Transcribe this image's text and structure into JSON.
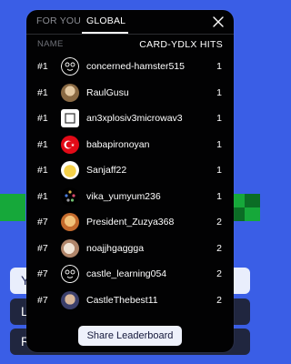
{
  "background": {
    "buttons": [
      "Y",
      "L",
      "R"
    ]
  },
  "tabs": [
    {
      "label": "FOR YOU",
      "active": false
    },
    {
      "label": "GLOBAL",
      "active": true
    }
  ],
  "columns": {
    "name": "NAME",
    "hits": "CARD-YDLX HITS"
  },
  "leaderboard": [
    {
      "rank": "#1",
      "name": "concerned-hamster515",
      "hits": "1",
      "avatar_icon": "hamster-icon"
    },
    {
      "rank": "#1",
      "name": "RaulGusu",
      "hits": "1",
      "avatar_icon": "user-photo-icon"
    },
    {
      "rank": "#1",
      "name": "an3xplosiv3microwav3",
      "hits": "1",
      "avatar_icon": "default-avatar-icon"
    },
    {
      "rank": "#1",
      "name": "babapironoyan",
      "hits": "1",
      "avatar_icon": "turkey-flag-icon"
    },
    {
      "rank": "#1",
      "name": "Sanjaff22",
      "hits": "1",
      "avatar_icon": "user-photo-icon"
    },
    {
      "rank": "#1",
      "name": "vika_yumyum236",
      "hits": "1",
      "avatar_icon": "dots-avatar-icon"
    },
    {
      "rank": "#7",
      "name": "President_Zuzya368",
      "hits": "2",
      "avatar_icon": "user-photo-icon"
    },
    {
      "rank": "#7",
      "name": "noajjhgaggga",
      "hits": "2",
      "avatar_icon": "user-photo-icon"
    },
    {
      "rank": "#7",
      "name": "castle_learning054",
      "hits": "2",
      "avatar_icon": "hamster-icon"
    },
    {
      "rank": "#7",
      "name": "CastleThebest11",
      "hits": "2",
      "avatar_icon": "user-photo-icon"
    }
  ],
  "share_label": "Share Leaderboard"
}
